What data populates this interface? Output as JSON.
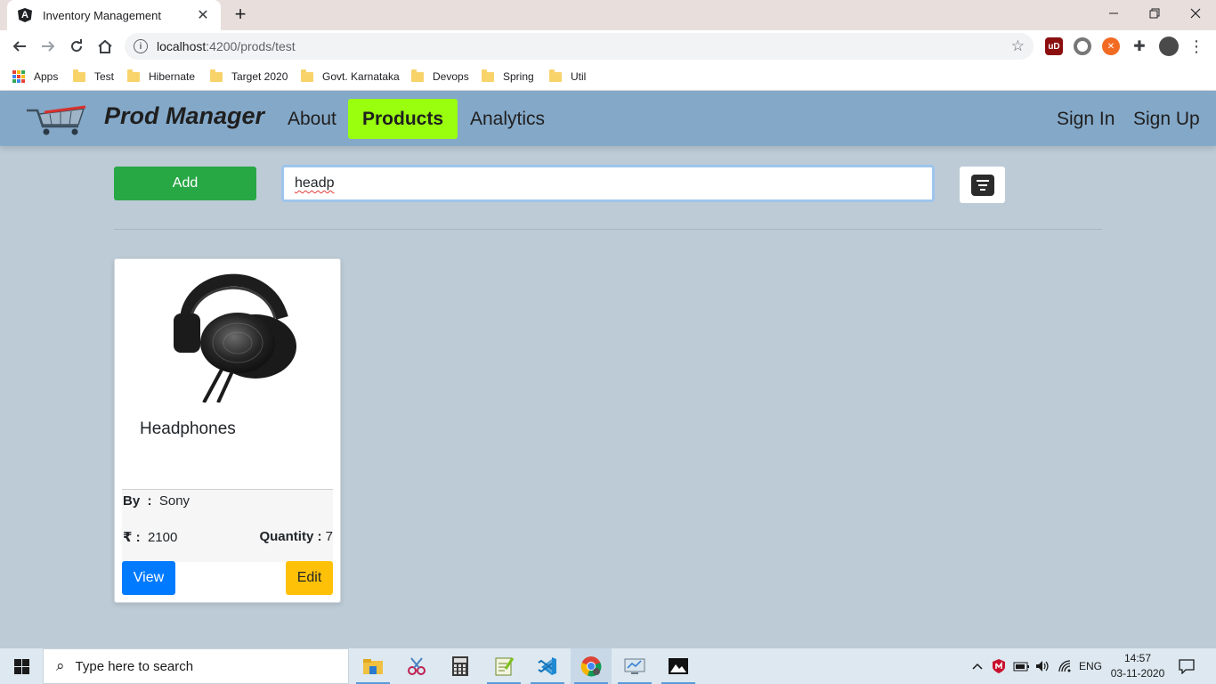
{
  "browser": {
    "tab_title": "Inventory Management",
    "tab_favicon": "A",
    "url_host": "localhost",
    "url_rest": ":4200/prods/test",
    "bookmarks": [
      "Apps",
      "Test",
      "Hibernate",
      "Target 2020",
      "Govt. Karnataka",
      "Devops",
      "Spring",
      "Util"
    ],
    "extensions": [
      "ublock-icon",
      "privacy-extension-icon",
      "orange-extension-icon",
      "puzzle-extensions-icon",
      "profile-avatar"
    ]
  },
  "navbar": {
    "brand": "Prod Manager",
    "links": [
      "About",
      "Products",
      "Analytics"
    ],
    "active_link": "Products",
    "auth": [
      "Sign In",
      "Sign Up"
    ],
    "bg_color": "#84a8c8",
    "active_color": "#99ff0f"
  },
  "controls": {
    "add_label": "Add",
    "search_value": "headp",
    "filter_icon": "filter-list-icon"
  },
  "products": [
    {
      "name": "Headphones",
      "by_label": "By",
      "brand": "Sony",
      "price_label": "₹",
      "price": "2100",
      "quantity_label": "Quantity",
      "quantity": "7",
      "image": "headphones-photo",
      "view_label": "View",
      "edit_label": "Edit"
    }
  ],
  "taskbar": {
    "search_placeholder": "Type here to search",
    "apps": [
      "file-explorer-icon",
      "snipping-tool-icon",
      "calculator-icon",
      "notepad-plus-icon",
      "vscode-icon",
      "chrome-icon",
      "remote-desktop-icon",
      "photos-icon"
    ],
    "language": "ENG",
    "time": "14:57",
    "date": "03-11-2020"
  }
}
